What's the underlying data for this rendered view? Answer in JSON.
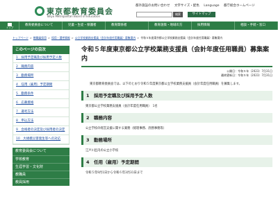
{
  "header": {
    "logo_title": "東京都教育委員会",
    "logo_sub": "Tokyo Metropolitan Board of Education",
    "toplinks": [
      "都外施設のお問い合わせ",
      "文字サイズ・配色",
      "Language",
      "都庁総合ホームページ"
    ],
    "search_placeholder": "",
    "search_button": "検索",
    "sitemap_label": "サイトマップ"
  },
  "nav": {
    "home_label": "トップ",
    "items": [
      "教育委員会について",
      "児童・生徒・保護者",
      "教育関係者",
      "教育施策・地域の方",
      "採用情報",
      "相談・手続・窓口"
    ]
  },
  "breadcrumb": [
    "トップページ",
    "教職員採用",
    "採用・選考情報",
    "公立学校業務支援員（会計年度任用職員）募集案内",
    "令和５年度東京都公立学校業務支援員（会計年度任用職員）募集案内"
  ],
  "sidebar": {
    "toc_title": "このページの目次",
    "toc_items": [
      "1　採用予定職及び採用予定人数",
      "2　職務内容",
      "3　勤務場所",
      "4　任用（雇用）予定期間",
      "5　勤務条件",
      "6　応募資格",
      "7　選考方法",
      "8　申込方法",
      "9　合格者の決定及び採用者の決定",
      "10　大規模災害発生等への対応"
    ],
    "section_title": "教育委員会について",
    "section_items": [
      "学校教育",
      "生涯学習・文化財",
      "教職員",
      "教員採用"
    ]
  },
  "main": {
    "title": "令和５年度東京都公立学校業務支援員（会計年度任用職員）募集案内",
    "published": "公開日：令和５年（2023）7月31日",
    "updated": "最終更新日：令和５年（2023）7月31日",
    "intro": "東京都教育委員会では、以下のとおり令和５年度東京都公立学校業務支援員（会計年度任用職員）を募集します。",
    "sections": [
      {
        "heading": "1　採用予定職及び採用予定人数",
        "body": "東京都公立学校業務支援員（会計年度任用職員）　1名"
      },
      {
        "heading": "2　職務内容",
        "body": "公立学校の経営支援に関する業務（経理事務、庶務事務等）"
      },
      {
        "heading": "3　勤務場所",
        "body": "江戸川区内の公立小学校"
      },
      {
        "heading": "4　任用（雇用）予定期間",
        "body": "令和５年9月1日から令和６年3月31日まで"
      }
    ]
  },
  "colors": {
    "brand_green": "#2e7d46",
    "link_blue": "#1f4fa0",
    "section_bg": "#e7f2e9"
  }
}
